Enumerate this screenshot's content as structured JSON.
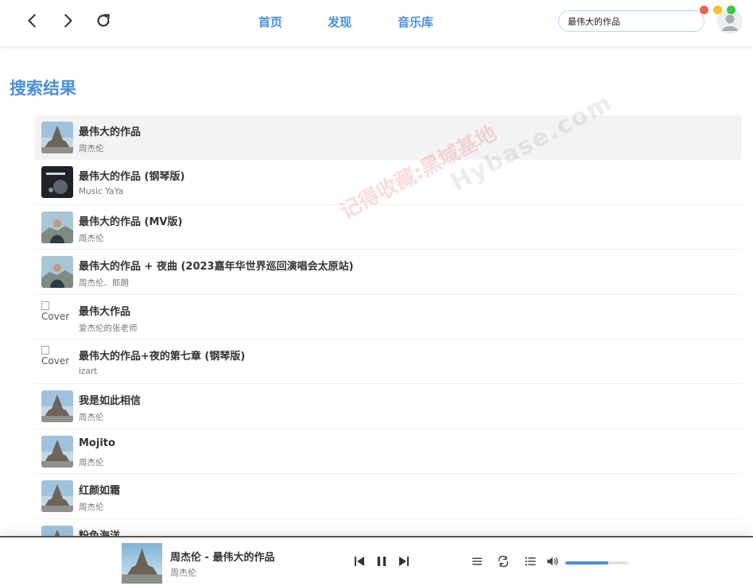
{
  "header": {
    "nav": [
      "首页",
      "发现",
      "音乐库"
    ],
    "search_value": "最伟大的作品"
  },
  "page_title": "搜索结果",
  "results": [
    {
      "title": "最伟大的作品",
      "artist": "周杰伦",
      "cover": "castle"
    },
    {
      "title": "最伟大的作品 (钢琴版)",
      "artist": "Music YaYa",
      "cover": "piano"
    },
    {
      "title": "最伟大的作品 (MV版)",
      "artist": "周杰伦",
      "cover": "person"
    },
    {
      "title": "最伟大的作品 + 夜曲 (2023嘉年华世界巡回演唱会太原站)",
      "artist": "周杰伦、郎朗",
      "cover": "person"
    },
    {
      "title": "最伟大作品",
      "artist": "爱杰伦的张老师",
      "cover": "broken"
    },
    {
      "title": "最伟大的作品+夜的第七章 (钢琴版)",
      "artist": "izart",
      "cover": "broken"
    },
    {
      "title": "我是如此相信",
      "artist": "周杰伦",
      "cover": "castle"
    },
    {
      "title": "Mojito",
      "artist": "周杰伦",
      "cover": "castle"
    },
    {
      "title": "红颜如霜",
      "artist": "周杰伦",
      "cover": "castle"
    },
    {
      "title": "粉色海洋",
      "artist": "",
      "cover": "castle"
    }
  ],
  "broken_cover_alt": "Cover",
  "watermark": {
    "line1": "记得收藏:黑域基地",
    "line2": "Hybase.com"
  },
  "player": {
    "title": "周杰伦 - 最伟大的作品",
    "artist": "周杰伦",
    "volume": 0.68
  },
  "colors": {
    "accent": "#4a90d9",
    "close": "#f25f58",
    "minimize": "#fbbe2e",
    "maximize": "#3bc94a"
  }
}
